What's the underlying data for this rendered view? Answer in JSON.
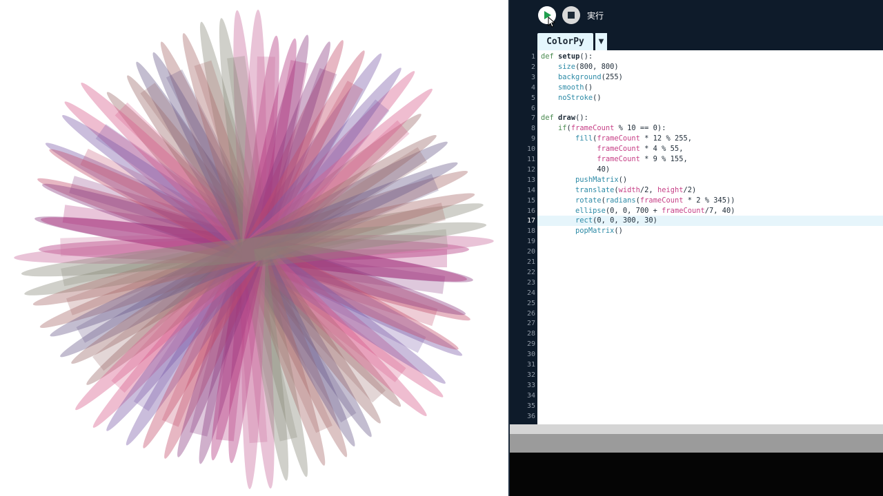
{
  "toolbar": {
    "run_icon": "play-icon",
    "stop_icon": "stop-icon",
    "run_label": "実行"
  },
  "tab": {
    "name": "ColorPy",
    "dropdown_glyph": "▼"
  },
  "editor": {
    "active_line": 17,
    "line_count": 36,
    "lines": [
      "def setup():",
      "    size(800, 800)",
      "    background(255)",
      "    smooth()",
      "    noStroke()",
      "",
      "def draw():",
      "    if(frameCount % 10 == 0):",
      "        fill(frameCount * 12 % 255,",
      "             frameCount * 4 % 55,",
      "             frameCount * 9 % 155,",
      "             40)",
      "        pushMatrix()",
      "        translate(width/2, height/2)",
      "        rotate(radians(frameCount * 2 % 345))",
      "        ellipse(0, 0, 700 + frameCount/7, 40)",
      "        rect(0, 0, 300, 30)",
      "        popMatrix()"
    ]
  },
  "sketch": {
    "background": "#ffffff",
    "palette": [
      "#b0307a",
      "#8a3a80",
      "#c24a6a",
      "#7a5aa8",
      "#d65a8a",
      "#9b6a6a",
      "#6a5a8a",
      "#a86a6a",
      "#8a8a7a",
      "#c86a9a"
    ],
    "petal_angles_deg": [
      0,
      8,
      18,
      27,
      38,
      47,
      58,
      66,
      77,
      86,
      96,
      104,
      113,
      123,
      132,
      141,
      151,
      160,
      169,
      178,
      188,
      197,
      206,
      215,
      224,
      234,
      243,
      252,
      262,
      271,
      281,
      290,
      299,
      309,
      318,
      328,
      337,
      346,
      354
    ],
    "petal_opacity": 0.4
  },
  "colors": {
    "ide_background": "#0e1b2a",
    "editor_background": "#ffffff",
    "active_line": "#e6f5fb",
    "keyword": "#4a8a50",
    "builtin": "#2c8aa6",
    "variable": "#c63f86",
    "run_green": "#1f9e4d"
  }
}
